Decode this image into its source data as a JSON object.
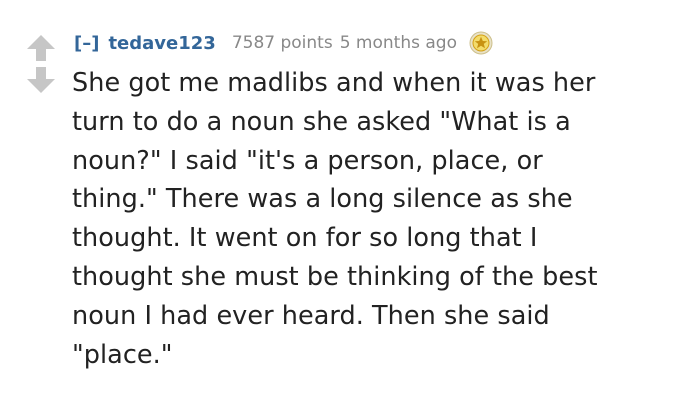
{
  "comment": {
    "expand_label": "[–]",
    "author": "tedave123",
    "score": "7587 points",
    "time": "5 months ago",
    "icons": {
      "upvote": "up-arrow-icon",
      "downvote": "down-arrow-icon",
      "award": "gold-star-award-icon"
    },
    "colors": {
      "author": "#336699",
      "meta": "#888888",
      "body": "#222222",
      "arrow": "#c6c6c6",
      "award": "#d4a017"
    },
    "body_lines": [
      "She got me madlibs and when it was her",
      "turn to do a noun she asked \"What is a",
      "noun?\" I said \"it's a person, place, or",
      "thing.\" There was a long silence as she",
      "thought. It went on for so long that I",
      "thought she must be thinking of the best",
      "noun I had ever heard. Then she said",
      "\"place.\""
    ]
  }
}
